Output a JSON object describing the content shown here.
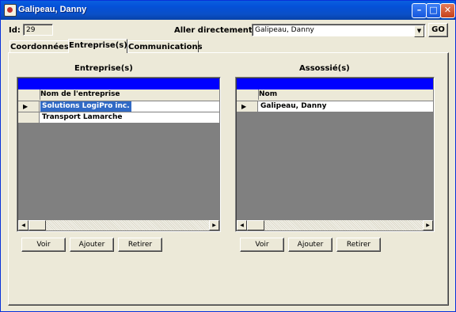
{
  "window": {
    "title": "Galipeau, Danny",
    "minimize_icon": "minimize-icon",
    "maximize_icon": "maximize-icon",
    "close_icon": "close-icon"
  },
  "header": {
    "id_label": "Id:",
    "id_value": "29",
    "goto_label": "Aller directement à :",
    "goto_value": "Galipeau,  Danny",
    "go_label": "GO"
  },
  "tabs": [
    {
      "label": "Coordonnées",
      "active": false
    },
    {
      "label": "Entreprise(s)",
      "active": true
    },
    {
      "label": "Communications",
      "active": false
    }
  ],
  "left": {
    "title": "Entreprise(s)",
    "column": "Nom de l'entreprise",
    "rows": [
      {
        "value": "Solutions LogiPro inc.",
        "current": true
      },
      {
        "value": "Transport Lamarche",
        "current": false
      }
    ],
    "buttons": {
      "view": "Voir",
      "add": "Ajouter",
      "remove": "Retirer"
    }
  },
  "right": {
    "title": "Assossié(s)",
    "column": "Nom",
    "rows": [
      {
        "value": "Galipeau, Danny",
        "current": true
      }
    ],
    "buttons": {
      "view": "Voir",
      "add": "Ajouter",
      "remove": "Retirer"
    }
  },
  "colors": {
    "title_bar": "#0a50d8",
    "grid_caption": "#0000ff",
    "grid_empty": "#808080",
    "selection": "#316ac5",
    "face": "#ece9d8"
  }
}
